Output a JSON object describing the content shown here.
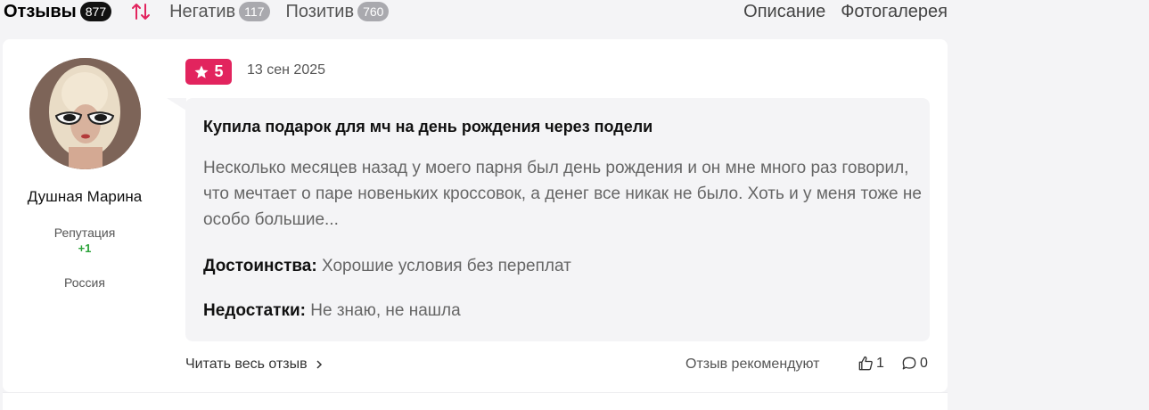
{
  "tabs": {
    "reviews": {
      "label": "Отзывы",
      "count": "877"
    },
    "negative": {
      "label": "Негатив",
      "count": "117"
    },
    "positive": {
      "label": "Позитив",
      "count": "760"
    },
    "description": "Описание",
    "gallery": "Фотогалерея"
  },
  "icons": {
    "sort": "sort-arrows-icon",
    "star": "star-icon",
    "chevron": "chevron-right-icon",
    "thumb": "thumbs-up-icon",
    "comment": "comment-icon"
  },
  "colors": {
    "accent": "#e2245e",
    "reputation": "#2ca33a",
    "badge": "#a9a9ae"
  },
  "review": {
    "author": {
      "name": "Душная Марина",
      "reputation_label": "Репутация",
      "reputation_value": "+1",
      "country": "Россия"
    },
    "rating": "5",
    "date": "13 сен 2025",
    "title": "Купила подарок для мч на день рождения через подели",
    "text": "Несколько месяцев назад у моего парня был день рождения и он мне много раз говорил, что мечтает о паре новеньких кроссовок, а денег все никак не было. Хоть и у меня тоже не особо большие...",
    "pros_label": "Достоинства:",
    "pros": "Хорошие условия без переплат",
    "cons_label": "Недостатки:",
    "cons": "Не знаю, не нашла",
    "read_more": "Читать весь отзыв",
    "recommend": "Отзыв рекомендуют",
    "likes": "1",
    "comments": "0"
  }
}
